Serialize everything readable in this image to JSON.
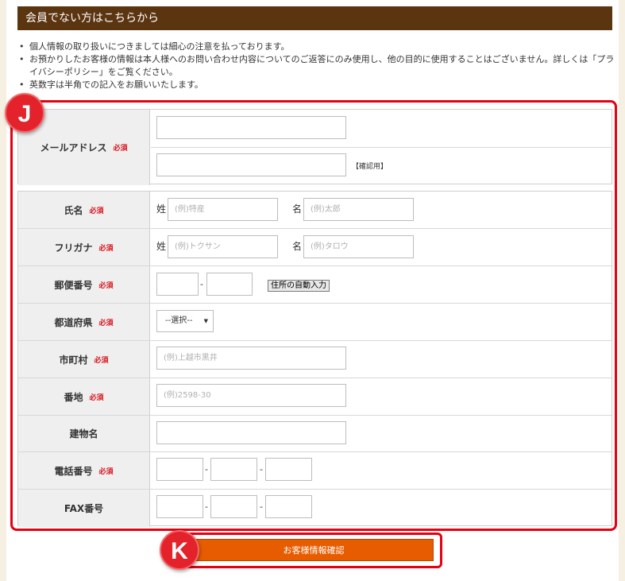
{
  "section": {
    "title": "会員でない方はこちらから"
  },
  "notes": [
    "個人情報の取り扱いにつきましては細心の注意を払っております。",
    "お預かりしたお客様の情報は本人様へのお問い合わせ内容についてのご返答にのみ使用し、他の目的に使用することはございません。詳しくは「プライバシーポリシー」をご覧ください。",
    "英数字は半角での記入をお願いいたします。"
  ],
  "bullet": "•",
  "badges": {
    "j": "J",
    "k": "K"
  },
  "required": "必須",
  "email": {
    "label": "メールアドレス",
    "confirm_note": "【確認用】"
  },
  "name": {
    "label": "氏名",
    "last_prefix": "姓",
    "last_placeholder": "(例)特産",
    "first_prefix": "名",
    "first_placeholder": "(例)太郎"
  },
  "furigana": {
    "label": "フリガナ",
    "last_prefix": "姓",
    "last_placeholder": "(例)トクサン",
    "first_prefix": "名",
    "first_placeholder": "(例)タロウ"
  },
  "postal": {
    "label": "郵便番号",
    "dash": "-",
    "auto_button": "住所の自動入力"
  },
  "prefecture": {
    "label": "都道府県",
    "selected": "--選択--"
  },
  "city": {
    "label": "市町村",
    "placeholder": "(例)上越市黒井"
  },
  "street": {
    "label": "番地",
    "placeholder": "(例)2598-30"
  },
  "building": {
    "label": "建物名"
  },
  "phone": {
    "label": "電話番号",
    "dash": "-"
  },
  "fax": {
    "label": "FAX番号",
    "dash": "-"
  },
  "submit": {
    "label": "お客様情報確認"
  }
}
